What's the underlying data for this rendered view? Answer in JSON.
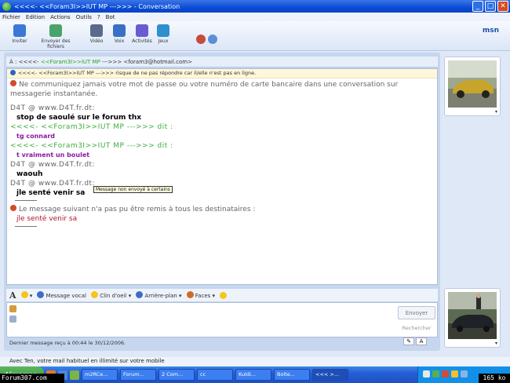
{
  "window": {
    "title": "<<<<-    <<Foram3I>>IUT MP     --->>> - Conversation",
    "buttons": [
      "_",
      "□",
      "✕"
    ]
  },
  "menu": [
    "Fichier",
    "Edition",
    "Actions",
    "Outils",
    "?",
    "Bot"
  ],
  "toolbar": {
    "buttons": [
      {
        "label": "Inviter",
        "icon": "invite-icon",
        "color": "#3a77d6"
      },
      {
        "label": "Envoyer des fichiers",
        "icon": "send-files-icon",
        "color": "#4aa36a"
      },
      {
        "label": "Vidéo",
        "icon": "webcam-icon",
        "color": "#5a6a8a"
      },
      {
        "label": "Voix",
        "icon": "voice-icon",
        "color": "#3a6fc4"
      },
      {
        "label": "Activités",
        "icon": "activities-icon",
        "color": "#6b5bd2"
      },
      {
        "label": "Jeux",
        "icon": "games-icon",
        "color": "#2f8fd0"
      }
    ],
    "brand": "msn"
  },
  "to_bar": {
    "prefix": "À : <<<<-    ",
    "nick": "<<Foram3I>>IUT MP",
    "suffix": "     --->>>  <foram3@hotmail.com>"
  },
  "info_strip": "<<<<-    <<Foram3I>>IUT MP     --->>> risque de ne pas répondre car il/elle n'est pas en ligne.",
  "conversation": {
    "warning": "Ne communiquez jamais votre mot de passe ou votre numéro de carte bancaire dans une conversation sur messagerie instantanée.",
    "entries": [
      {
        "sender": "D4T @ www.D4T.fr.dt:",
        "sender_color": "gray",
        "message": "stop de saoulé sur le forum thx",
        "msg_style": "black"
      },
      {
        "sender": "<<<<-    <<Foram3I>>IUT MP     --->>> dit :",
        "sender_color": "green",
        "message": "tg connard",
        "msg_style": "purple"
      },
      {
        "sender": "<<<<-    <<Foram3I>>IUT MP     --->>> dit :",
        "sender_color": "green",
        "message": "t vraiment un boulet",
        "msg_style": "purple"
      },
      {
        "sender": "D4T @ www.D4T.fr.dt:",
        "sender_color": "gray",
        "message": "waouh",
        "msg_style": "black"
      },
      {
        "sender": "D4T @ www.D4T.fr.dt:",
        "sender_color": "gray",
        "message": "jle senté venir sa",
        "msg_style": "black"
      }
    ],
    "tooltip": "Message non envoyé à certains",
    "failed_notice": "Le message suivant n'a pas pu être remis à tous les destinataires :",
    "failed_message": "jle senté venir sa"
  },
  "format_bar": {
    "font": "A",
    "message_voice": "Message vocal",
    "wink": "Clin d'oeil",
    "background": "Arrière-plan",
    "nudge": "Faces"
  },
  "compose": {
    "send": "Envoyer",
    "search": "Rechercher",
    "status": "Dernier message reçu à 00:44 le 30/12/2006."
  },
  "ad_bar": "Avec Ten, votre mail habituel en illimité sur votre mobile",
  "taskbar": {
    "start": "démarrer",
    "tasks": [
      "m2RCe...",
      "Forum...",
      "2 Com...",
      "cc",
      "Kuldi...",
      "Bolte...",
      "<<< >..."
    ],
    "active_task": 6
  },
  "overlays": {
    "watermark": "Forum307.com",
    "speed": "165 ko"
  }
}
